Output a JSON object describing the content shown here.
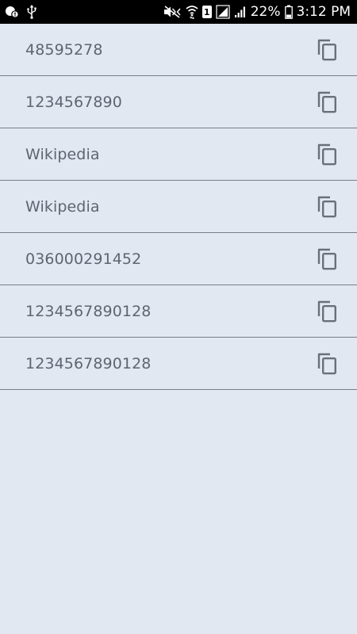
{
  "status_bar": {
    "battery_percent": "22%",
    "time": "3:12 PM",
    "sim_badge": "1",
    "icons": [
      "notification-icon",
      "usb-icon",
      "mute-icon",
      "wifi-icon",
      "sim-icon",
      "signal-icon",
      "signal-icon",
      "battery-icon"
    ]
  },
  "list": {
    "items": [
      {
        "label": "48595278",
        "action_icon": "copy-icon"
      },
      {
        "label": "1234567890",
        "action_icon": "copy-icon"
      },
      {
        "label": "Wikipedia",
        "action_icon": "copy-icon"
      },
      {
        "label": "Wikipedia",
        "action_icon": "copy-icon"
      },
      {
        "label": "036000291452",
        "action_icon": "copy-icon"
      },
      {
        "label": "1234567890128",
        "action_icon": "copy-icon"
      },
      {
        "label": "1234567890128",
        "action_icon": "copy-icon"
      }
    ]
  },
  "colors": {
    "background": "#e1e8f2",
    "status_bar": "#000000",
    "text": "#5f6570",
    "icon": "#6b7078",
    "divider": "#7a7e84"
  }
}
